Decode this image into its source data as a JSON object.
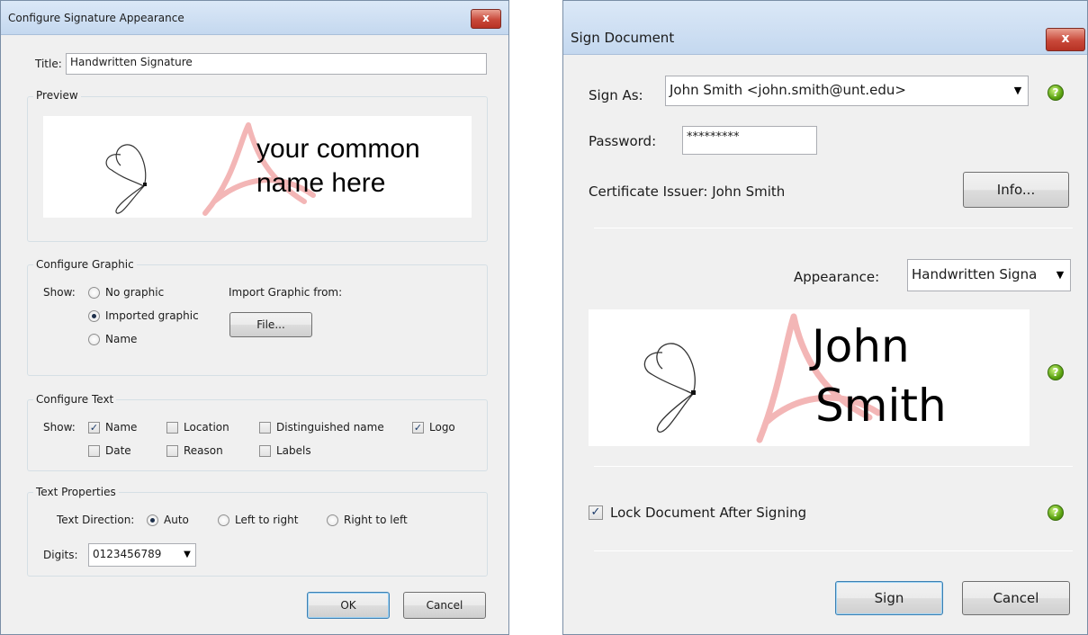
{
  "left_dialog": {
    "title": "Configure Signature Appearance",
    "close_glyph": "x",
    "title_label": "Title:",
    "title_value": "Handwritten Signature",
    "preview": {
      "label": "Preview",
      "name_text_line1": "your common",
      "name_text_line2": "name here"
    },
    "configure_graphic": {
      "label": "Configure Graphic",
      "show_label": "Show:",
      "options": [
        "No graphic",
        "Imported graphic",
        "Name"
      ],
      "selected": "Imported graphic",
      "import_label": "Import Graphic from:",
      "file_button": "File..."
    },
    "configure_text": {
      "label": "Configure Text",
      "show_label": "Show:",
      "name": "Name",
      "location": "Location",
      "distinguished_name": "Distinguished name",
      "logo": "Logo",
      "date": "Date",
      "reason": "Reason",
      "labels": "Labels",
      "checked": [
        "Name",
        "Logo"
      ]
    },
    "text_properties": {
      "label": "Text Properties",
      "direction_label": "Text Direction:",
      "auto": "Auto",
      "ltr": "Left to right",
      "rtl": "Right to left",
      "selected": "Auto",
      "digits_label": "Digits:",
      "digits_value": "0123456789"
    },
    "ok_button": "OK",
    "cancel_button": "Cancel"
  },
  "right_dialog": {
    "title": "Sign Document",
    "close_glyph": "x",
    "sign_as_label": "Sign As:",
    "sign_as_value": "John Smith <john.smith@unt.edu>",
    "password_label": "Password:",
    "password_value": "*********",
    "cert_issuer": "Certificate Issuer: John Smith",
    "info_button": "Info...",
    "appearance_label": "Appearance:",
    "appearance_value": "Handwritten Signa",
    "preview_name_line1": "John",
    "preview_name_line2": "Smith",
    "lock_label": "Lock Document After Signing",
    "lock_checked": true,
    "sign_button": "Sign",
    "cancel_button": "Cancel",
    "help_glyph": "?"
  },
  "colors": {
    "title_bar": "#c4d8ef",
    "close_button": "#c9493a",
    "help_icon": "#5ca312",
    "acrobat_logo": "#f3b6b6"
  }
}
